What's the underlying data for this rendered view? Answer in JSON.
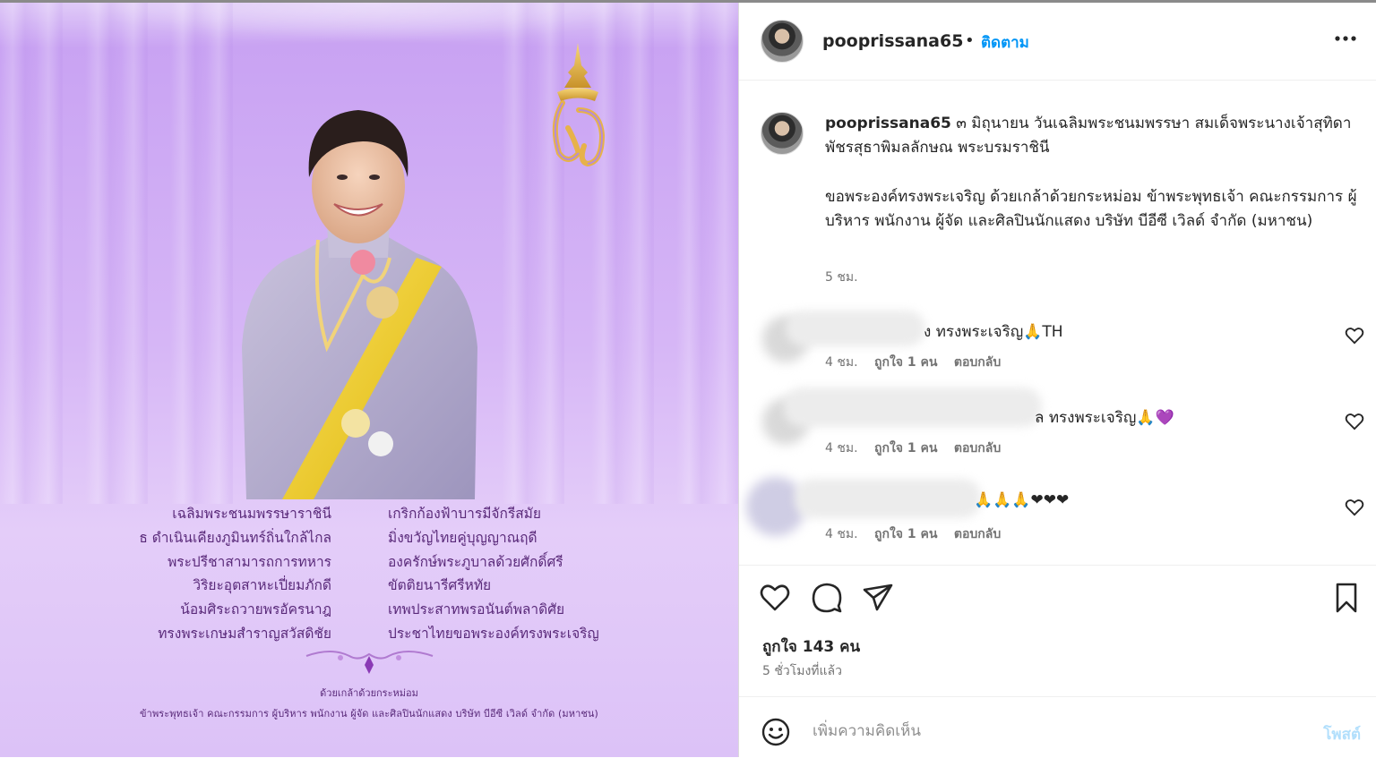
{
  "image": {
    "poem_left": [
      "เฉลิมพระชนมพรรษาราชินี",
      "ธ ดำเนินเคียงภูมินทร์ถิ่นใกล้ไกล",
      "พระปรีชาสามารถการทหาร",
      "วิริยะอุตสาหะเปี่ยมภักดี",
      "น้อมศิระถวายพรอัครนาฎ",
      "ทรงพระเกษมสำราญสวัสดิชัย"
    ],
    "poem_right": [
      "เกริกก้องฟ้าบารมีจักรีสมัย",
      "มิ่งขวัญไทยคู่บุญญาณฤดี",
      "องครักษ์พระภูบาลด้วยศักดิ์ศรี",
      "ขัตติยนารีศรีหทัย",
      "เทพประสาทพรอนันต์พลาดิศัย",
      "ประชาไทยขอพระองค์ทรงพระเจริญ"
    ],
    "credit_title": "ด้วยเกล้าด้วยกระหม่อม",
    "credit_line": "ข้าพระพุทธเจ้า คณะกรรมการ ผู้บริหาร พนักงาน ผู้จัด และศิลปินนักแสดง บริษัท บีอีซี เวิลด์ จำกัด (มหาชน)"
  },
  "header": {
    "username": "pooprissana65",
    "separator": "•",
    "follow_label": "ติดตาม"
  },
  "caption": {
    "username": "pooprissana65",
    "text1": "๓ มิถุนายน วันเฉลิมพระชนมพรรษา สมเด็จพระนางเจ้าสุทิดา พัชรสุธาพิมลลักษณ พระบรมราชินี",
    "text2": "ขอพระองค์ทรงพระเจริญ ด้วยเกล้าด้วยกระหม่อม ข้าพระพุทธเจ้า คณะกรรมการ ผู้บริหาร พนักงาน ผู้จัด และศิลปินนักแสดง บริษัท บีอีซี เวิลด์ จำกัด (มหาชน)",
    "time": "5 ชม."
  },
  "comments": [
    {
      "text": "ง ทรงพระเจริญ🙏TH",
      "time": "4 ชม.",
      "likes": "ถูกใจ 1 คน",
      "reply": "ตอบกลับ"
    },
    {
      "text": "ล ทรงพระเจริญ🙏💜",
      "time": "4 ชม.",
      "likes": "ถูกใจ 1 คน",
      "reply": "ตอบกลับ"
    },
    {
      "text": "🙏🙏🙏❤❤❤",
      "time": "4 ชม.",
      "likes": "ถูกใจ 1 คน",
      "reply": "ตอบกลับ"
    }
  ],
  "stats": {
    "likes": "ถูกใจ 143 คน",
    "time": "5 ชั่วโมงที่แล้ว"
  },
  "add_comment": {
    "placeholder": "เพิ่มความคิดเห็น",
    "post_label": "โพสต์"
  },
  "colors": {
    "accent": "#0095f6",
    "post_disabled": "#b2dffc",
    "image_bg": "#d6b6f6",
    "poem_text": "#5a2a7a"
  }
}
